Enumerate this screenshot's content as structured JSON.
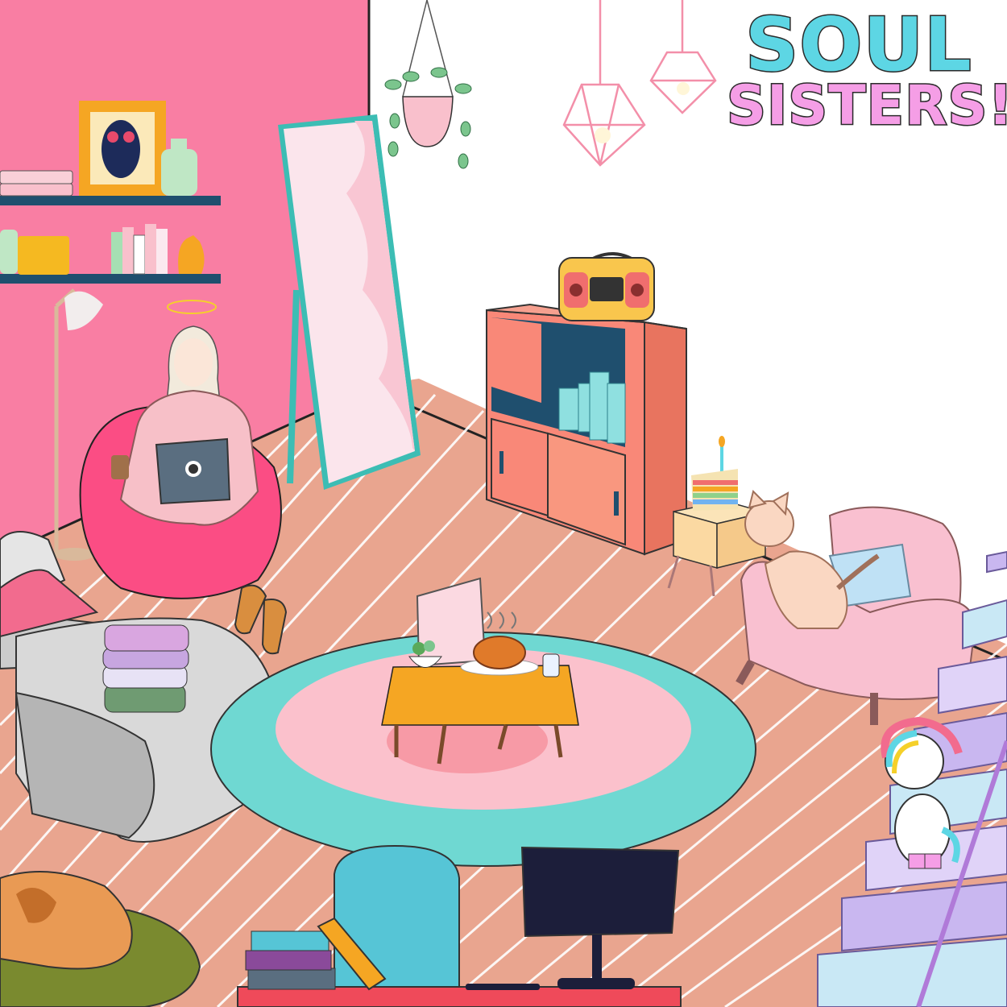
{
  "title": {
    "line1": "SOUL",
    "line2": "SISTERS!!"
  },
  "colors": {
    "wall_pink": "#f97ea3",
    "floor": "#e9a58f",
    "rug_outer": "#6fd8d2",
    "rug_inner": "#fbc1cc",
    "title_cyan": "#5dd6e4",
    "title_pink": "#f59ee6",
    "shelf_navy": "#1f4f6e",
    "cabinet_coral": "#f98878"
  },
  "scene_objects": [
    "picture-frame-icon",
    "wall-shelves",
    "floor-lamp-icon",
    "hanging-plant-icon",
    "pendant-lamp-icon",
    "standing-mirror",
    "boombox-icon",
    "bookcase-cabinet",
    "cake-icon",
    "nightstand",
    "cat-icon",
    "armchair",
    "bean-bag",
    "girl-with-laptop",
    "bed",
    "folded-towels-icon",
    "sandals-icon",
    "round-rug",
    "coffee-table",
    "roast-chicken-icon",
    "unicorn-icon",
    "staircase",
    "sleeping-dog-icon",
    "desk",
    "monitor-icon",
    "book-stack-icon"
  ]
}
